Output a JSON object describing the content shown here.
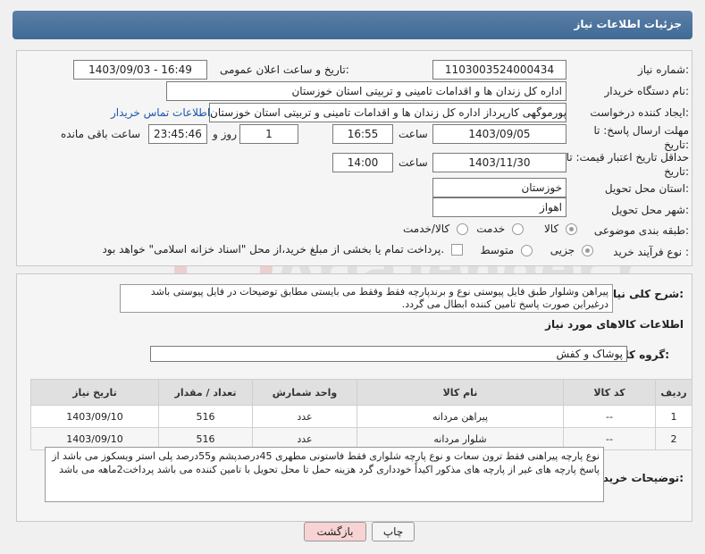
{
  "header": {
    "title": "جزئیات اطلاعات نیاز"
  },
  "fields": {
    "need_number_label": "شماره نیاز:",
    "need_number": "1103003524000434",
    "announce_label": "تاریخ و ساعت اعلان عمومی:",
    "announce_value": "1403/09/03 - 16:49",
    "buyer_org_label": "نام دستگاه خریدار:",
    "buyer_org": "اداره کل زندان ها و اقدامات تامینی و تربیتی استان خوزستان",
    "creator_label": "ایجاد کننده درخواست:",
    "creator": "مجید درویش پورموگهی کارپرداز اداره کل زندان ها و اقدامات تامینی و تربیتی استان خوزستان",
    "contact_link": "اطلاعات تماس خریدار",
    "send_deadline_label": "مهلت ارسال پاسخ: تا تاریخ:",
    "send_date": "1403/09/05",
    "time_label": "ساعت",
    "send_time": "16:55",
    "days_count": "1",
    "days_label": "روز و",
    "remaining_time": "23:45:46",
    "remaining_label": "ساعت باقی مانده",
    "price_validity_label": "حداقل تاریخ اعتبار قیمت: تا تاریخ:",
    "price_date": "1403/11/30",
    "price_time": "14:00",
    "province_label": "استان محل تحویل:",
    "province": "خوزستان",
    "city_label": "شهر محل تحویل:",
    "city": "اهواز",
    "category_label": "طبقه بندی موضوعی:",
    "category_options": [
      "کالا",
      "خدمت",
      "کالا/خدمت"
    ],
    "category_selected": "کالا",
    "process_label": "نوع فرآیند خرید :",
    "process_options": [
      "جزیی",
      "متوسط"
    ],
    "process_selected": "جزیی",
    "payment_note": "پرداخت تمام یا بخشی از مبلغ خرید،از محل \"اسناد خزانه اسلامی\" خواهد بود."
  },
  "description": {
    "label": "شرح کلی نیاز:",
    "text": "پیراهن وشلوار طبق فایل پیوستی نوع و برندپارچه فقط وفقط می بایستی مطابق توضیحات در فایل پیوستی باشد درغیراین صورت پاسخ تامین کننده ابطال می گردد."
  },
  "goods": {
    "section_title": "اطلاعات کالاهای مورد نیاز",
    "group_label": "گروه کالا:",
    "group_value": "پوشاک و کفش",
    "columns": [
      "ردیف",
      "کد کالا",
      "نام کالا",
      "واحد شمارش",
      "تعداد / مقدار",
      "تاریخ نیاز"
    ],
    "rows": [
      [
        "1",
        "--",
        "پیراهن مردانه",
        "عدد",
        "516",
        "1403/09/10"
      ],
      [
        "2",
        "--",
        "شلوار مردانه",
        "عدد",
        "516",
        "1403/09/10"
      ]
    ]
  },
  "buyer_notes": {
    "label": "توضیحات خریدار:",
    "text": "نوع پارچه پیراهنی فقط ترون سعات و نوع پارچه شلواری فقط فاستونی مطهری 45درصدپشم و55درصد پلی استر ویسکوز می باشد از پاسخ پارچه های غیر از پارچه های مذکور اکیداً خودداری گرد هزینه حمل تا محل تحویل با تامین کننده می باشد پرداخت2ماهه می باشد"
  },
  "buttons": {
    "print": "چاپ",
    "back": "بازگشت"
  },
  "watermark": "AriaTender.neT",
  "colors": {
    "header": "#4a719c",
    "link": "#1a56b0",
    "back_button": "#f7d3d3"
  }
}
